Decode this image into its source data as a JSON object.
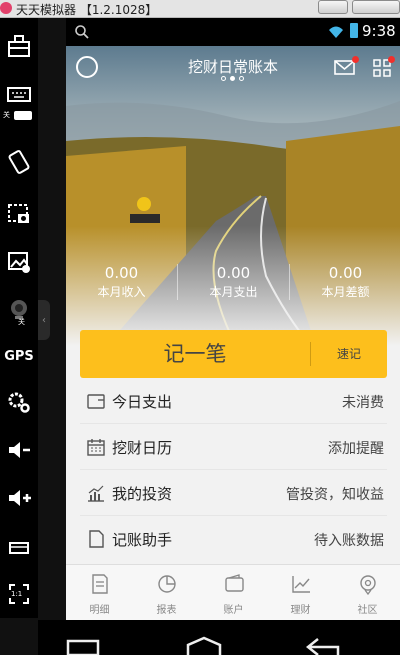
{
  "window": {
    "title": "天天模拟器 【1.2.1028】"
  },
  "sidebar": {
    "items": [
      {
        "icon": "android-robot-icon"
      },
      {
        "icon": "keyboard-icon",
        "toggle_label": "关"
      },
      {
        "icon": "rotate-screen-icon"
      },
      {
        "icon": "screenshot-icon"
      },
      {
        "icon": "image-import-icon"
      },
      {
        "icon": "camera-icon",
        "toggle_label": "关"
      },
      {
        "label": "GPS"
      },
      {
        "icon": "settings-icon"
      },
      {
        "icon": "volume-down-icon"
      },
      {
        "icon": "volume-up-icon"
      },
      {
        "icon": "menu-icon"
      },
      {
        "icon": "fullscreen-icon",
        "badge": "1:1"
      }
    ],
    "collapse_handle": "‹"
  },
  "statusbar": {
    "time": "9:38"
  },
  "header": {
    "title": "挖财日常账本"
  },
  "stats": [
    {
      "value": "0.00",
      "label": "本月收入"
    },
    {
      "value": "0.00",
      "label": "本月支出"
    },
    {
      "value": "0.00",
      "label": "本月差额"
    }
  ],
  "record": {
    "main_label": "记一笔",
    "secondary_label": "速记"
  },
  "list": [
    {
      "label": "今日支出",
      "value": "未消费",
      "icon": "wallet-card-icon"
    },
    {
      "label": "挖财日历",
      "value": "添加提醒",
      "icon": "calendar-icon"
    },
    {
      "label": "我的投资",
      "value": "管投资，知收益",
      "icon": "bar-chart-icon"
    },
    {
      "label": "记账助手",
      "value": "待入账数据",
      "icon": "document-icon"
    }
  ],
  "tabs": [
    {
      "label": "明细",
      "icon": "receipt-icon"
    },
    {
      "label": "报表",
      "icon": "pie-chart-icon"
    },
    {
      "label": "账户",
      "icon": "wallet-icon"
    },
    {
      "label": "理财",
      "icon": "trend-chart-icon"
    },
    {
      "label": "社区",
      "icon": "community-icon"
    }
  ],
  "colors": {
    "accent": "#fdbf1c",
    "notification": "#f1302c",
    "battery": "#43b5e8"
  }
}
